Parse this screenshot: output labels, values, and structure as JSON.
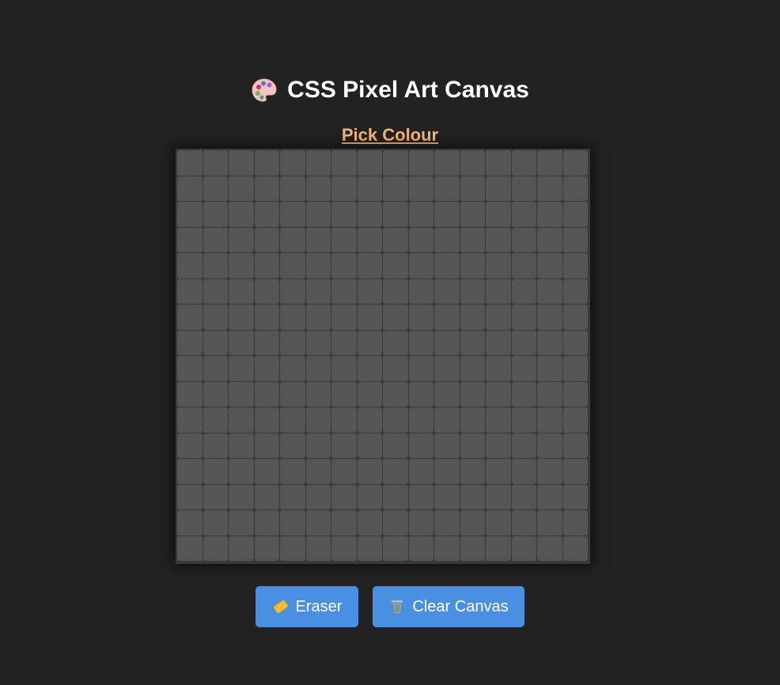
{
  "header": {
    "title": "CSS Pixel Art Canvas",
    "icon": "palette-icon"
  },
  "picker": {
    "label": "Pick Colour",
    "color": "#f4b378"
  },
  "canvas": {
    "rows": 16,
    "cols": 16,
    "cell_color": "#555555",
    "background": "#222222"
  },
  "toolbar": {
    "eraser_label": "Eraser",
    "eraser_icon": "sponge-icon",
    "clear_label": "Clear Canvas",
    "clear_icon": "wastebasket-icon",
    "button_color": "#4a90e2"
  }
}
